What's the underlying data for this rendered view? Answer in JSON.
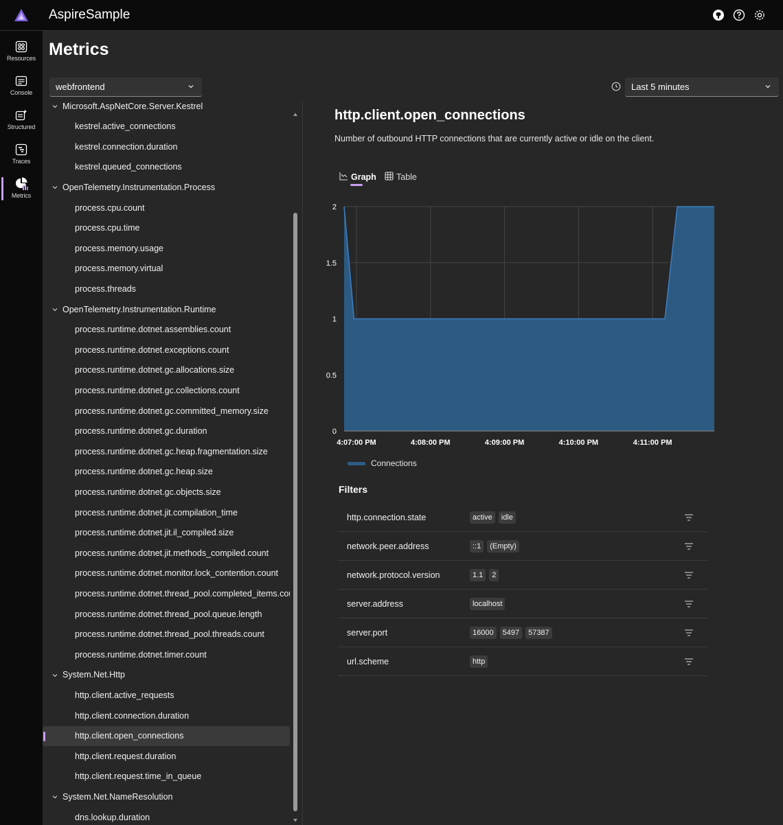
{
  "app": {
    "title": "AspireSample",
    "accent": "#c79ff2"
  },
  "header": {
    "actions": [
      "github-icon",
      "help-icon",
      "settings-icon"
    ]
  },
  "nav": {
    "items": [
      {
        "label": "Resources",
        "icon": "resources-icon"
      },
      {
        "label": "Console",
        "icon": "console-icon"
      },
      {
        "label": "Structured",
        "icon": "structured-icon"
      },
      {
        "label": "Traces",
        "icon": "traces-icon"
      },
      {
        "label": "Metrics",
        "icon": "metrics-icon",
        "active": true
      }
    ]
  },
  "page": {
    "title": "Metrics",
    "resource_select": "webfrontend",
    "time_select": "Last 5 minutes"
  },
  "tree": {
    "rows": [
      {
        "label": "Microsoft.AspNetCore.Server.Kestrel",
        "group": true
      },
      {
        "label": "kestrel.active_connections"
      },
      {
        "label": "kestrel.connection.duration"
      },
      {
        "label": "kestrel.queued_connections"
      },
      {
        "label": "OpenTelemetry.Instrumentation.Process",
        "group": true
      },
      {
        "label": "process.cpu.count"
      },
      {
        "label": "process.cpu.time"
      },
      {
        "label": "process.memory.usage"
      },
      {
        "label": "process.memory.virtual"
      },
      {
        "label": "process.threads"
      },
      {
        "label": "OpenTelemetry.Instrumentation.Runtime",
        "group": true
      },
      {
        "label": "process.runtime.dotnet.assemblies.count"
      },
      {
        "label": "process.runtime.dotnet.exceptions.count"
      },
      {
        "label": "process.runtime.dotnet.gc.allocations.size"
      },
      {
        "label": "process.runtime.dotnet.gc.collections.count"
      },
      {
        "label": "process.runtime.dotnet.gc.committed_memory.size"
      },
      {
        "label": "process.runtime.dotnet.gc.duration"
      },
      {
        "label": "process.runtime.dotnet.gc.heap.fragmentation.size"
      },
      {
        "label": "process.runtime.dotnet.gc.heap.size"
      },
      {
        "label": "process.runtime.dotnet.gc.objects.size"
      },
      {
        "label": "process.runtime.dotnet.jit.compilation_time"
      },
      {
        "label": "process.runtime.dotnet.jit.il_compiled.size"
      },
      {
        "label": "process.runtime.dotnet.jit.methods_compiled.count"
      },
      {
        "label": "process.runtime.dotnet.monitor.lock_contention.count"
      },
      {
        "label": "process.runtime.dotnet.thread_pool.completed_items.count"
      },
      {
        "label": "process.runtime.dotnet.thread_pool.queue.length"
      },
      {
        "label": "process.runtime.dotnet.thread_pool.threads.count"
      },
      {
        "label": "process.runtime.dotnet.timer.count"
      },
      {
        "label": "System.Net.Http",
        "group": true
      },
      {
        "label": "http.client.active_requests"
      },
      {
        "label": "http.client.connection.duration"
      },
      {
        "label": "http.client.open_connections",
        "selected": true
      },
      {
        "label": "http.client.request.duration"
      },
      {
        "label": "http.client.request.time_in_queue"
      },
      {
        "label": "System.Net.NameResolution",
        "group": true
      },
      {
        "label": "dns.lookup.duration"
      }
    ]
  },
  "metric": {
    "title": "http.client.open_connections",
    "description": "Number of outbound HTTP connections that are currently active or idle on the client.",
    "tabs": [
      {
        "label": "Graph",
        "icon": "graph-icon",
        "active": true
      },
      {
        "label": "Table",
        "icon": "table-icon"
      }
    ]
  },
  "chart_data": {
    "type": "area",
    "x": [
      "4:06:50 PM",
      "4:06:58 PM",
      "4:07:00 PM",
      "4:08:00 PM",
      "4:09:00 PM",
      "4:10:00 PM",
      "4:11:00 PM",
      "4:11:10 PM",
      "4:11:20 PM",
      "4:11:30 PM",
      "4:11:50 PM"
    ],
    "series": [
      {
        "name": "Connections",
        "values": [
          2,
          1,
          1,
          1,
          1,
          1,
          1,
          1,
          2,
          2,
          2
        ],
        "color": "#2c5d86",
        "stroke": "#3c7cc0"
      }
    ],
    "x_ticks": [
      "4:07:00 PM",
      "4:08:00 PM",
      "4:09:00 PM",
      "4:10:00 PM",
      "4:11:00 PM"
    ],
    "y_ticks": [
      "0",
      "0.5",
      "1",
      "1.5",
      "2"
    ],
    "ylim": [
      0,
      2
    ],
    "grid": true,
    "legend": "bottom-left"
  },
  "filters": {
    "title": "Filters",
    "rows": [
      {
        "name": "http.connection.state",
        "values": [
          "active",
          "idle"
        ]
      },
      {
        "name": "network.peer.address",
        "values": [
          "::1",
          "(Empty)"
        ]
      },
      {
        "name": "network.protocol.version",
        "values": [
          "1.1",
          "2"
        ]
      },
      {
        "name": "server.address",
        "values": [
          "localhost"
        ]
      },
      {
        "name": "server.port",
        "values": [
          "16000",
          "5497",
          "57387"
        ]
      },
      {
        "name": "url.scheme",
        "values": [
          "http"
        ]
      }
    ]
  }
}
